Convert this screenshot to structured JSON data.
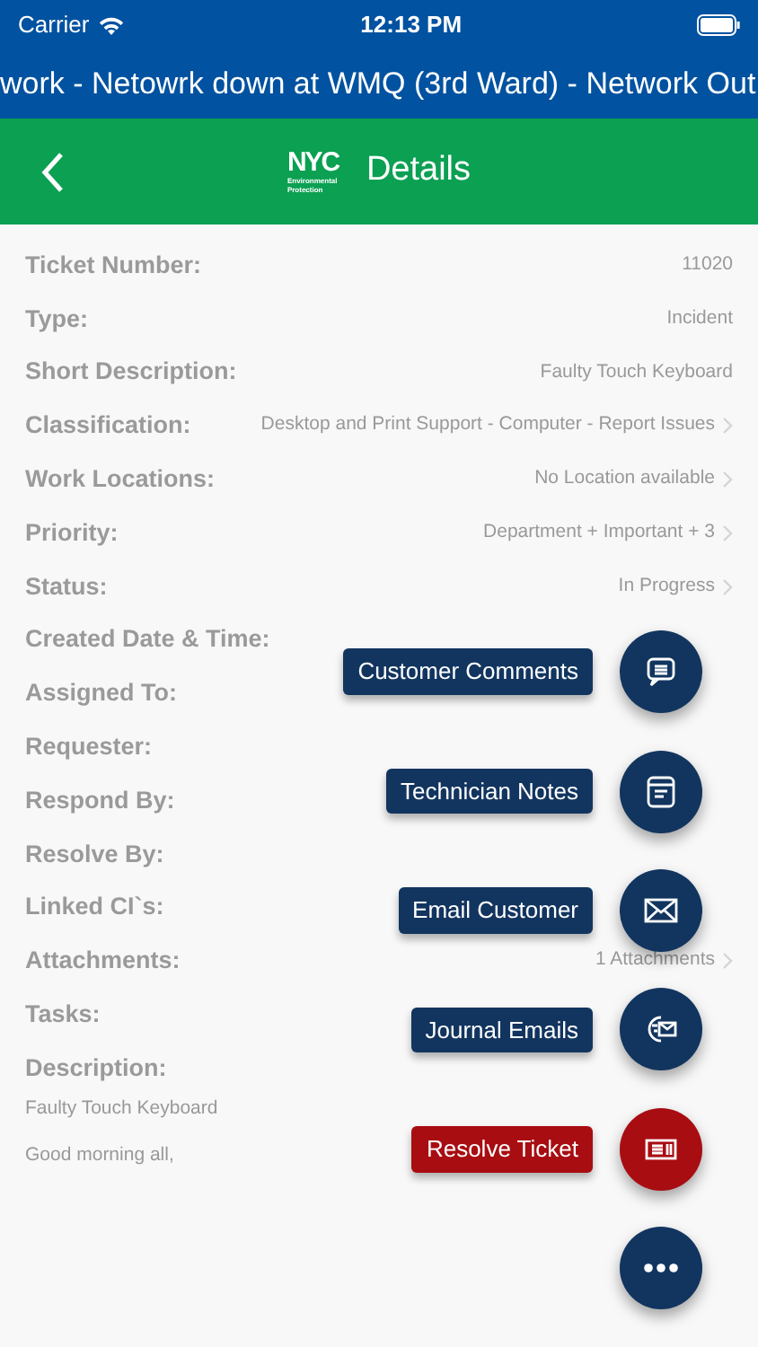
{
  "status_bar": {
    "carrier": "Carrier",
    "time": "12:13 PM"
  },
  "banner": {
    "text": "work - Netowrk down at WMQ (3rd Ward) - Network Out"
  },
  "nav": {
    "logo": "NYC",
    "logo_sub": "Environmental Protection",
    "title": "Details"
  },
  "fields": [
    {
      "label": "Ticket Number:",
      "value": "11020",
      "chevron": false
    },
    {
      "label": "Type:",
      "value": "Incident",
      "chevron": false
    },
    {
      "label": "Short Description:",
      "value": "Faulty Touch Keyboard",
      "chevron": false
    },
    {
      "label": "Classification:",
      "value": "Desktop and Print Support - Computer - Report Issues",
      "chevron": true
    },
    {
      "label": "Work Locations:",
      "value": "No Location available",
      "chevron": true
    },
    {
      "label": "Priority:",
      "value": "Department + Important + 3",
      "chevron": true
    },
    {
      "label": "Status:",
      "value": "In Progress",
      "chevron": true
    },
    {
      "label": "Created Date & Time:"
    },
    {
      "label": "Assigned To:"
    },
    {
      "label": "Requester:"
    },
    {
      "label": "Respond By:"
    },
    {
      "label": "Resolve By:"
    },
    {
      "label": "Linked CI`s:"
    },
    {
      "label": "Attachments:",
      "value": "1 Attachments",
      "chevron": true
    },
    {
      "label": "Tasks:"
    }
  ],
  "description": {
    "label": "Description:",
    "paragraphs": [
      "Faulty Touch Keyboard",
      "Good morning all,"
    ]
  },
  "actions": [
    {
      "kind": "comments",
      "label": "Customer Comments",
      "color": "#12355f"
    },
    {
      "kind": "notes",
      "label": "Technician Notes",
      "color": "#12355f"
    },
    {
      "kind": "email",
      "label": "Email Customer",
      "color": "#12355f"
    },
    {
      "kind": "journal",
      "label": "Journal Emails",
      "color": "#12355f"
    },
    {
      "kind": "resolve",
      "label": "Resolve Ticket",
      "color": "#a80d12"
    },
    {
      "kind": "more",
      "color": "#12355f"
    }
  ]
}
